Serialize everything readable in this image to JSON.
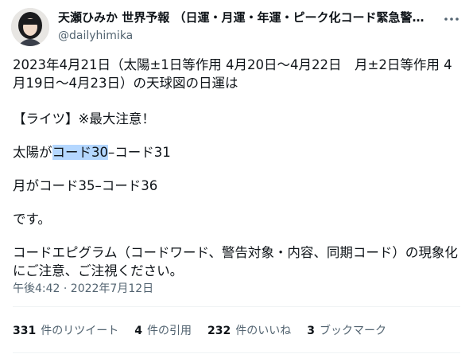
{
  "author": {
    "display_name": "天瀬ひみか 世界予報 （日運・月運・年運・ピーク化コード緊急警…",
    "handle": "@dailyhimika",
    "avatar_icon": "portrait-avatar",
    "more_icon": "more-options-icon"
  },
  "tweet": {
    "line1": "2023年4月21日（太陽±1日等作用 4月20日〜4月22日　月±2日等作用 4月19日〜4月23日）の天球図の日運は",
    "line2": "【ライツ】※最大注意！",
    "line3_prefix": "太陽が",
    "line3_highlight": "コード30",
    "line3_suffix": "–コード31",
    "line4": "月がコード35–コード36",
    "line5": "です。",
    "line6": "コードエピグラム（コードワード、警告対象・内容、同期コード）の現象化にご注意、ご注視ください。",
    "timestamp": "午後4:42 · 2022年7月12日",
    "highlight_color": "#b4d7ff"
  },
  "stats": {
    "retweets_count": "331",
    "retweets_label": "件のリツイート",
    "quotes_count": "4",
    "quotes_label": "件の引用",
    "likes_count": "232",
    "likes_label": "件のいいね",
    "bookmarks_count": "3",
    "bookmarks_label": "ブックマーク"
  }
}
